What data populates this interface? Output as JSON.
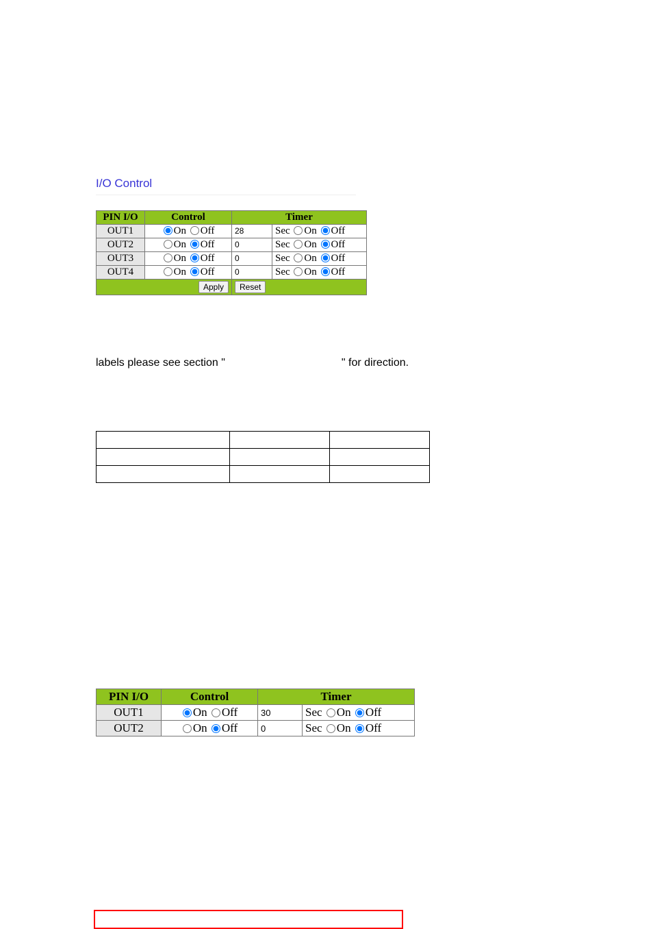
{
  "section_title": "I/O Control",
  "table1": {
    "headers": {
      "pin": "PIN I/O",
      "control": "Control",
      "timer": "Timer"
    },
    "labels": {
      "on": "On",
      "off": "Off",
      "sec": "Sec"
    },
    "rows": [
      {
        "pin": "OUT1",
        "control": "on",
        "timer_value": "28",
        "timer_state": "off"
      },
      {
        "pin": "OUT2",
        "control": "off",
        "timer_value": "0",
        "timer_state": "off"
      },
      {
        "pin": "OUT3",
        "control": "off",
        "timer_value": "0",
        "timer_state": "off"
      },
      {
        "pin": "OUT4",
        "control": "off",
        "timer_value": "0",
        "timer_state": "off"
      }
    ],
    "buttons": {
      "apply": "Apply",
      "reset": "Reset"
    }
  },
  "mid_text": {
    "prefix": "labels please see section \"",
    "suffix": "\" for direction."
  },
  "table2": {
    "headers": {
      "pin": "PIN I/O",
      "control": "Control",
      "timer": "Timer"
    },
    "labels": {
      "on": "On",
      "off": "Off",
      "sec": "Sec"
    },
    "rows": [
      {
        "pin": "OUT1",
        "control": "on",
        "timer_value": "30",
        "timer_state": "off"
      },
      {
        "pin": "OUT2",
        "control": "off",
        "timer_value": "0",
        "timer_state": "off"
      }
    ]
  }
}
